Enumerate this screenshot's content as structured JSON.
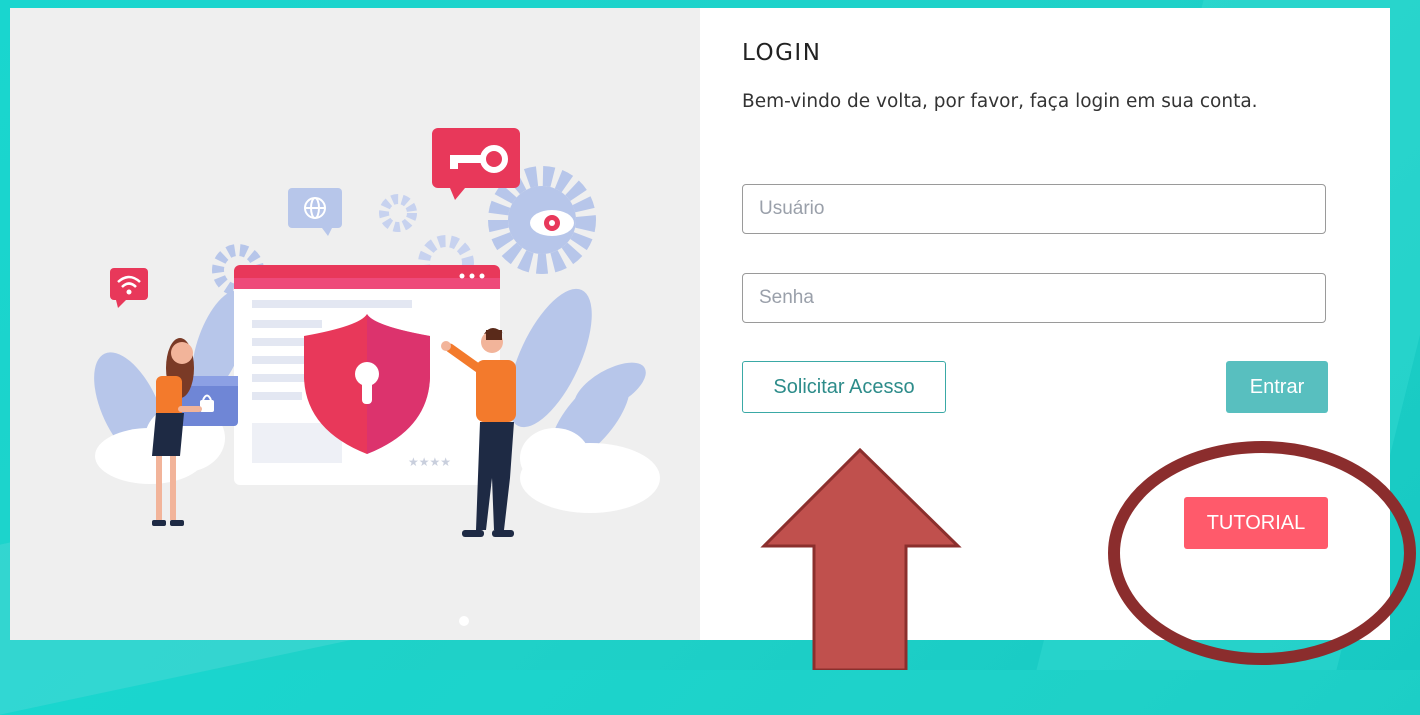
{
  "login": {
    "title": "LOGIN",
    "welcome": "Bem-vindo de volta, por favor, faça login em sua conta.",
    "username_placeholder": "Usuário",
    "password_placeholder": "Senha",
    "request_access_label": "Solicitar Acesso",
    "enter_label": "Entrar",
    "tutorial_label": "TUTORIAL"
  },
  "colors": {
    "background": "#1fd1c8",
    "enter_button": "#58bfbf",
    "tutorial_button": "#ff5a6b",
    "annotation": "#b94a48"
  },
  "icons": [
    "key-icon",
    "globe-icon",
    "gear-icon",
    "eye-icon",
    "wifi-icon",
    "shield-lock-icon",
    "folder-lock-icon"
  ]
}
